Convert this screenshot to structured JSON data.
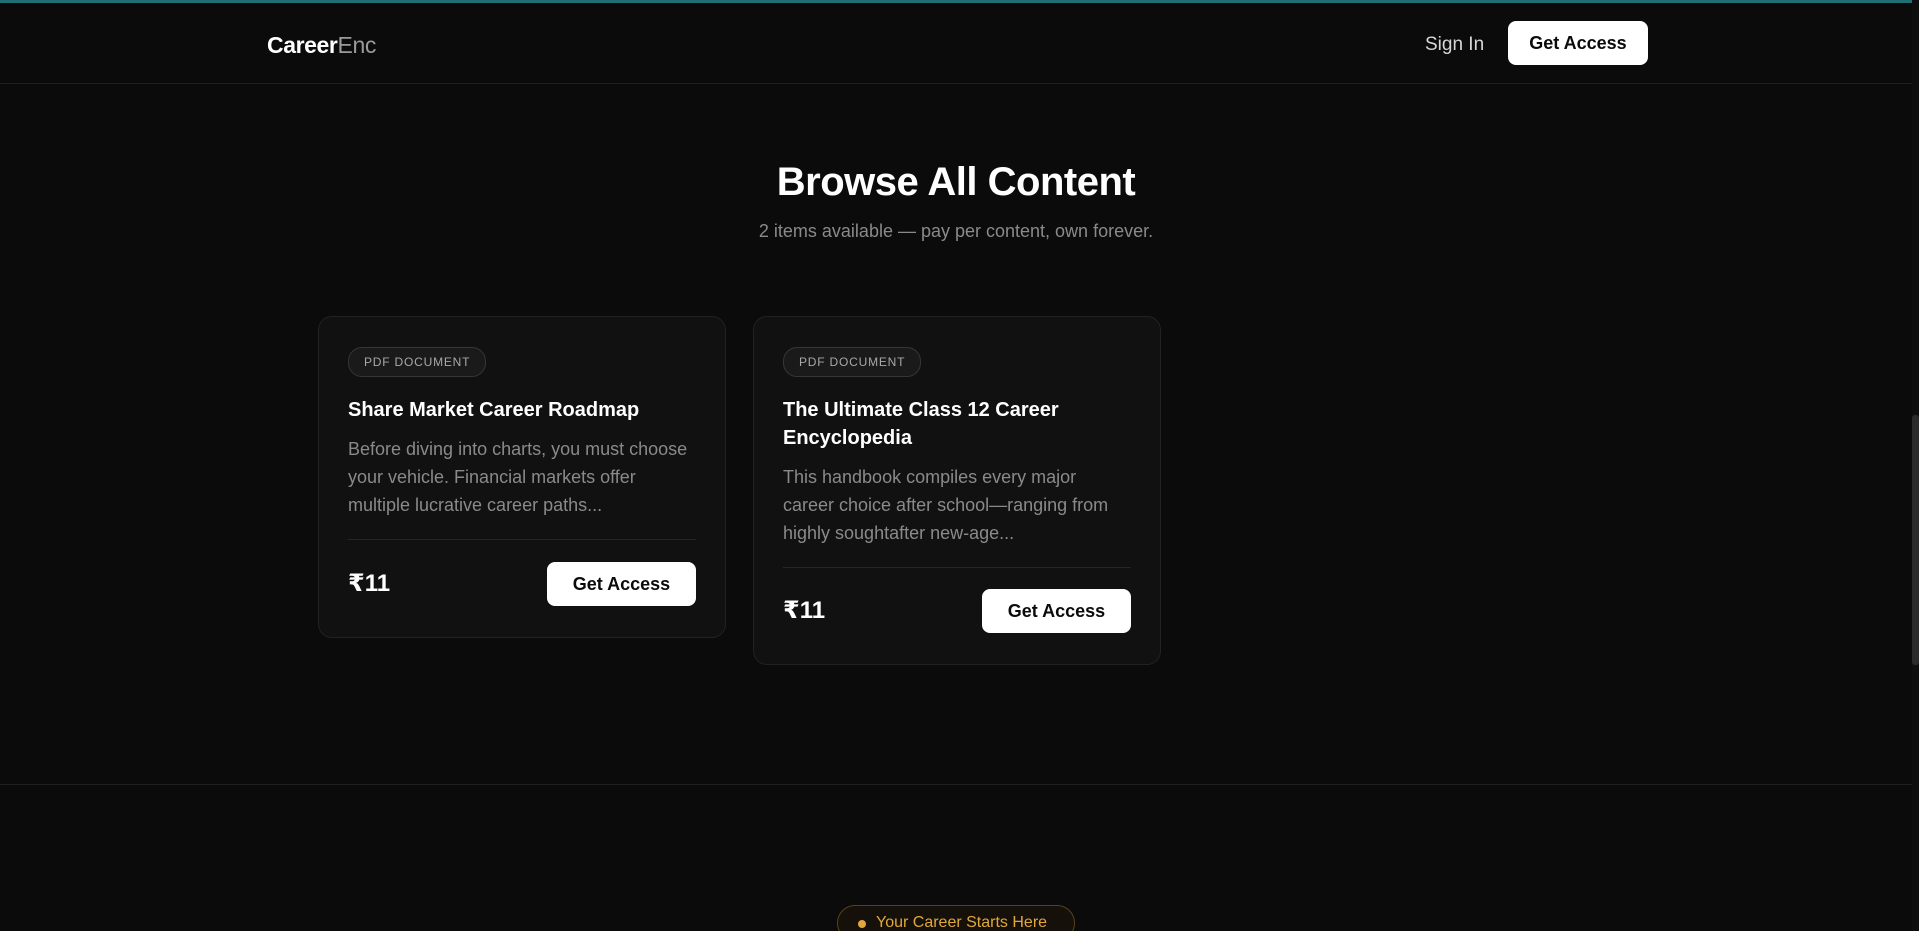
{
  "brand": {
    "name_strong": "Career",
    "name_light": "Enc"
  },
  "header": {
    "signin_label": "Sign In",
    "cta_label": "Get Access"
  },
  "hero": {
    "title": "Browse All Content",
    "subtitle": "2 items available — pay per content, own forever."
  },
  "cards": [
    {
      "badge": "PDF DOCUMENT",
      "title": "Share Market Career Roadmap",
      "description": "Before diving into charts, you must choose your vehicle. Financial markets offer multiple lucrative career paths...",
      "price": "₹11",
      "cta_label": "Get Access"
    },
    {
      "badge": "PDF DOCUMENT",
      "title": "The Ultimate Class 12 Career Encyclopedia",
      "description": "This handbook compiles every major career choice after school—ranging from highly soughtafter new-age...",
      "price": "₹11",
      "cta_label": "Get Access"
    }
  ],
  "footer_pill": {
    "label": "Your Career Starts Here"
  },
  "colors": {
    "background": "#0b0b0b",
    "top_accent": "#1f6f73",
    "card_background": "#111111",
    "button_background": "#ffffff",
    "muted_text": "#8a8a8a",
    "pill_accent": "#e0a83a"
  }
}
